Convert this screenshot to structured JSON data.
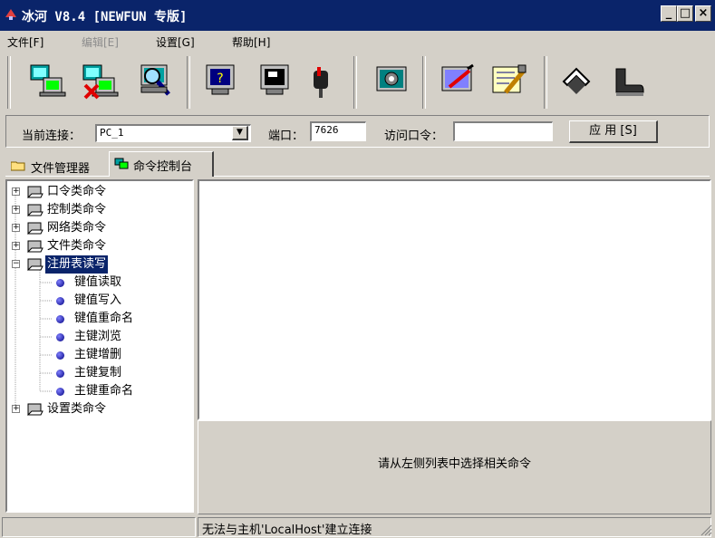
{
  "window": {
    "title": "冰河 V8.4 [NEWFUN 专版]",
    "min_glyph": "_",
    "max_glyph": "□",
    "close_glyph": "×"
  },
  "menu": [
    "文件[F]",
    "编辑[E]",
    "设置[G]",
    "帮助[H]"
  ],
  "toolbar": {
    "icons": [
      "add-host-icon",
      "delete-host-icon",
      "search-host-icon",
      "remote-screen-icon",
      "screen-control-icon",
      "mailbox-icon",
      "config-icon",
      "settings-panel-icon",
      "tools-icon",
      "home-icon",
      "boot-icon"
    ]
  },
  "connection": {
    "label": "当前连接：",
    "value": "PC_1",
    "port_label": "端口：",
    "port": "7626",
    "password_label": "访问口令：",
    "password": "",
    "apply_label": "应 用 [S]"
  },
  "tabs": [
    "文件管理器",
    "命令控制台"
  ],
  "tree": {
    "groups": [
      "口令类命令",
      "控制类命令",
      "网络类命令",
      "文件类命令",
      "注册表读写"
    ],
    "children": [
      "键值读取",
      "键值写入",
      "键值重命名",
      "主键浏览",
      "主键增删",
      "主键复制",
      "主键重命名"
    ],
    "last_group": "设置类命令"
  },
  "hint": "请从左侧列表中选择相关命令",
  "status": {
    "left": "",
    "message": "无法与主机'LocalHost'建立连接"
  },
  "colors": {
    "title_bar": "#0a246a",
    "face": "#d4d0c8",
    "selection": "#0a246a"
  }
}
